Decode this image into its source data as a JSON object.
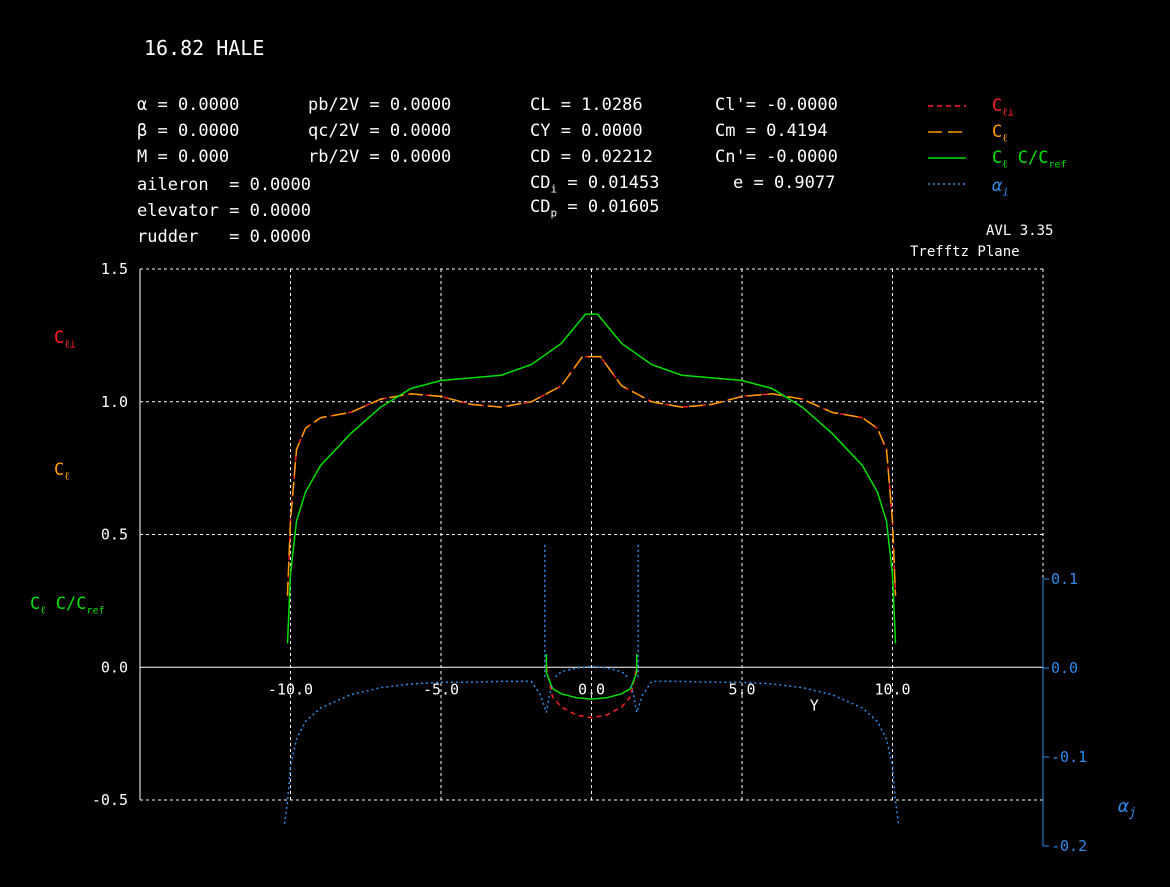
{
  "title": "16.82 HALE",
  "params": {
    "alpha": "α = 0.0000",
    "beta": "β = 0.0000",
    "mach": "M = 0.000",
    "pb2v": "pb/2V = 0.0000",
    "qc2v": "qc/2V = 0.0000",
    "rb2v": "rb/2V = 0.0000",
    "aileron": "aileron  = 0.0000",
    "elevator": "elevator = 0.0000",
    "rudder": "rudder   = 0.0000",
    "cl": "CL = 1.0286",
    "cy": "CY = 0.0000",
    "cd": "CD = 0.02212",
    "cdi": "CD",
    "cdi_sub": "i",
    "cdi_val": "= 0.01453",
    "cdp": "CD",
    "cdp_sub": "p",
    "cdp_val": "= 0.01605",
    "clp": "Cl'= -0.0000",
    "cm": "Cm = 0.4194",
    "cnp": "Cn'= -0.0000",
    "e": "e = 0.9077"
  },
  "version": "AVL 3.35",
  "plane": "Trefftz Plane",
  "legend": [
    {
      "key": "cl_perp",
      "main": "C",
      "sub": "ℓ⊥",
      "color": "#ff2020",
      "dash": "5,4"
    },
    {
      "key": "cl",
      "main": "C",
      "sub": "ℓ",
      "color": "#ff9c00",
      "dash": "14,6"
    },
    {
      "key": "clc",
      "main": "C",
      "sub": "ℓ",
      "extra": "C/C",
      "extra_sub": "ref",
      "color": "#00e000",
      "dash": ""
    },
    {
      "key": "alpha_i",
      "main": "α",
      "sub": "i",
      "color": "#2e8ce8",
      "dash": "2,3"
    }
  ],
  "side_labels": [
    {
      "main": "C",
      "sub": "ℓ⊥",
      "color": "#ff2020"
    },
    {
      "main": "C",
      "sub": "ℓ",
      "color": "#ff9c00"
    },
    {
      "main": "C",
      "sub": "ℓ",
      "extra": "C/C",
      "extra_sub": "ref",
      "color": "#00e000"
    }
  ],
  "right_axis_label": {
    "main": "α",
    "sub": "j",
    "color": "#2e8ce8"
  },
  "chart_data": {
    "type": "line",
    "xlabel": "Y",
    "xlim": [
      -15,
      15
    ],
    "ylim": [
      -0.5,
      1.5
    ],
    "xticks": [
      "-10.0",
      "-5.0",
      "0.0",
      "5.0",
      "10.0"
    ],
    "yticks": [
      "1.5",
      "1.0",
      "0.5",
      "0.0",
      "-0.5"
    ],
    "y2lim": [
      -0.2,
      0.1
    ],
    "y2ticks": [
      "0.1",
      "0.0",
      "-0.1",
      "-0.2"
    ],
    "grid": true,
    "legend_position": "top-right",
    "series": [
      {
        "key": "cl_perp",
        "color": "#ff2020",
        "x": [
          -10.1,
          -10.0,
          -9.8,
          -9.5,
          -9.0,
          -8.0,
          -7.0,
          -6.0,
          -5.0,
          -4.0,
          -3.0,
          -2.0,
          -1.0,
          -0.3,
          0.3,
          1.0,
          2.0,
          3.0,
          4.0,
          5.0,
          6.0,
          7.0,
          8.0,
          9.0,
          9.5,
          9.8,
          10.0,
          10.1
        ],
        "y": [
          0.27,
          0.55,
          0.82,
          0.9,
          0.94,
          0.96,
          1.01,
          1.03,
          1.02,
          0.99,
          0.98,
          1.0,
          1.06,
          1.17,
          1.17,
          1.06,
          1.0,
          0.98,
          0.99,
          1.02,
          1.03,
          1.01,
          0.96,
          0.94,
          0.9,
          0.82,
          0.55,
          0.27
        ]
      },
      {
        "key": "cl_perp_center",
        "color": "#ff2020",
        "x": [
          -1.5,
          -1.3,
          -1.0,
          -0.5,
          0.0,
          0.5,
          1.0,
          1.3,
          1.5
        ],
        "y": [
          0.0,
          -0.11,
          -0.15,
          -0.18,
          -0.19,
          -0.18,
          -0.15,
          -0.11,
          0.0
        ]
      },
      {
        "key": "cl",
        "color": "#ff9c00",
        "x": [
          -10.1,
          -10.0,
          -9.8,
          -9.5,
          -9.0,
          -8.0,
          -7.0,
          -6.0,
          -5.0,
          -4.0,
          -3.0,
          -2.0,
          -1.0,
          -0.3,
          0.3,
          1.0,
          2.0,
          3.0,
          4.0,
          5.0,
          6.0,
          7.0,
          8.0,
          9.0,
          9.5,
          9.8,
          10.0,
          10.1
        ],
        "y": [
          0.27,
          0.55,
          0.82,
          0.9,
          0.94,
          0.96,
          1.01,
          1.03,
          1.02,
          0.99,
          0.98,
          1.0,
          1.06,
          1.17,
          1.17,
          1.06,
          1.0,
          0.98,
          0.99,
          1.02,
          1.03,
          1.01,
          0.96,
          0.94,
          0.9,
          0.82,
          0.55,
          0.27
        ]
      },
      {
        "key": "clc",
        "color": "#00e000",
        "x": [
          -10.1,
          -10.0,
          -9.8,
          -9.5,
          -9.0,
          -8.0,
          -7.0,
          -6.0,
          -5.0,
          -4.0,
          -3.0,
          -2.0,
          -1.0,
          -0.2,
          0.2,
          1.0,
          2.0,
          3.0,
          4.0,
          5.0,
          6.0,
          7.0,
          8.0,
          9.0,
          9.5,
          9.8,
          10.0,
          10.1
        ],
        "y": [
          0.09,
          0.35,
          0.55,
          0.66,
          0.76,
          0.88,
          0.98,
          1.05,
          1.08,
          1.09,
          1.1,
          1.14,
          1.22,
          1.33,
          1.33,
          1.22,
          1.14,
          1.1,
          1.09,
          1.08,
          1.05,
          0.98,
          0.88,
          0.76,
          0.66,
          0.55,
          0.35,
          0.09
        ]
      },
      {
        "key": "clc_center",
        "color": "#00e000",
        "x": [
          -1.5,
          -1.5,
          -1.3,
          -1.0,
          -0.5,
          0.0,
          0.5,
          1.0,
          1.3,
          1.5,
          1.5
        ],
        "y": [
          0.05,
          -0.02,
          -0.08,
          -0.1,
          -0.115,
          -0.12,
          -0.115,
          -0.1,
          -0.08,
          -0.02,
          0.05
        ]
      },
      {
        "key": "alpha_i",
        "color": "#2e8ce8",
        "axis": "right",
        "x": [
          -10.2,
          -10.1,
          -10.0,
          -9.8,
          -9.5,
          -9.0,
          -8.0,
          -7.0,
          -6.0,
          -5.0,
          -4.0,
          -3.0,
          -2.0,
          -1.7,
          -1.5,
          -1.4,
          -1.3
        ],
        "y": [
          -0.175,
          -0.15,
          -0.11,
          -0.08,
          -0.06,
          -0.045,
          -0.03,
          -0.022,
          -0.018,
          -0.016,
          -0.016,
          -0.015,
          -0.015,
          -0.03,
          -0.05,
          -0.03,
          -0.02
        ]
      },
      {
        "key": "alpha_i_right",
        "color": "#2e8ce8",
        "axis": "right",
        "x": [
          1.3,
          1.4,
          1.5,
          1.7,
          2.0,
          3.0,
          4.0,
          5.0,
          6.0,
          7.0,
          8.0,
          9.0,
          9.5,
          9.8,
          10.0,
          10.1,
          10.2
        ],
        "y": [
          -0.02,
          -0.03,
          -0.05,
          -0.03,
          -0.015,
          -0.015,
          -0.016,
          -0.016,
          -0.018,
          -0.022,
          -0.03,
          -0.045,
          -0.06,
          -0.08,
          -0.11,
          -0.15,
          -0.175
        ]
      },
      {
        "key": "alpha_i_spike_l",
        "color": "#2e8ce8",
        "axis": "right",
        "x": [
          -1.55,
          -1.55
        ],
        "y": [
          -0.01,
          0.14
        ]
      },
      {
        "key": "alpha_i_spike_r",
        "color": "#2e8ce8",
        "axis": "right",
        "x": [
          1.55,
          1.55
        ],
        "y": [
          -0.01,
          0.14
        ]
      },
      {
        "key": "alpha_i_center",
        "color": "#2e8ce8",
        "axis": "right",
        "x": [
          -1.2,
          -1.0,
          -0.5,
          0.0,
          0.5,
          1.0,
          1.2
        ],
        "y": [
          -0.01,
          -0.004,
          0.0,
          0.002,
          0.0,
          -0.004,
          -0.01
        ]
      }
    ]
  }
}
